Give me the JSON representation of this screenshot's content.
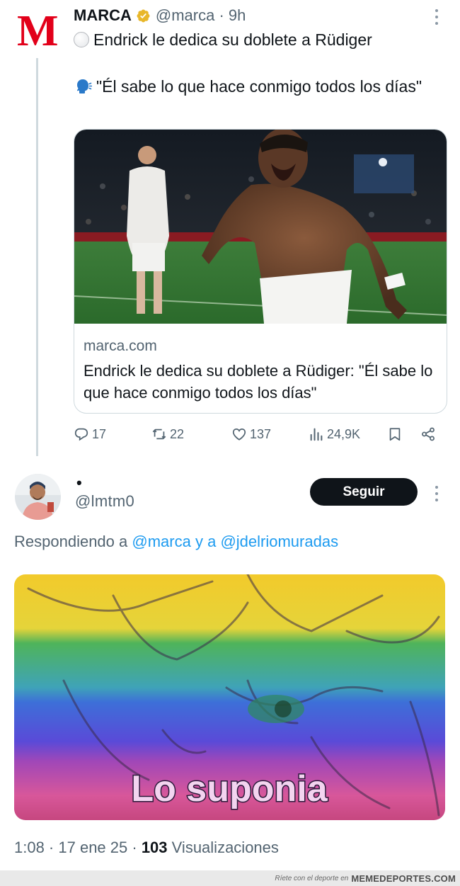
{
  "parent_tweet": {
    "author_name": "MARCA",
    "logo_letter": "M",
    "handle_time": "@marca · 9h",
    "text_line1": "Endrick le dedica su doblete a Rüdiger",
    "text_line2": "\"Él sabe lo que hace conmigo todos los días\"",
    "card": {
      "domain": "marca.com",
      "title": "Endrick le dedica su doblete a Rüdiger: \"Él sabe lo que hace conmigo todos los días\""
    },
    "actions": {
      "replies": "17",
      "retweets": "22",
      "likes": "137",
      "views": "24,9K"
    }
  },
  "reply_tweet": {
    "author_name": "•",
    "handle": "@lmtm0",
    "follow_label": "Seguir",
    "replying_prefix": "Respondiendo a",
    "mention1": "@marca",
    "replying_joiner": "y a",
    "mention2": "@jdelriomuradas",
    "meme_caption": "Lo suponia",
    "time_date": "1:08 · 17 ene 25 ·",
    "view_count": "103",
    "views_label": "Visualizaciones"
  },
  "footer": {
    "tagline": "Ríete con el deporte en",
    "brand": "MEMEDEPORTES.COM"
  },
  "colors": {
    "accent": "#1d9bf0",
    "marca_red": "#e2001a",
    "verified_gold": "#e8b72a"
  }
}
